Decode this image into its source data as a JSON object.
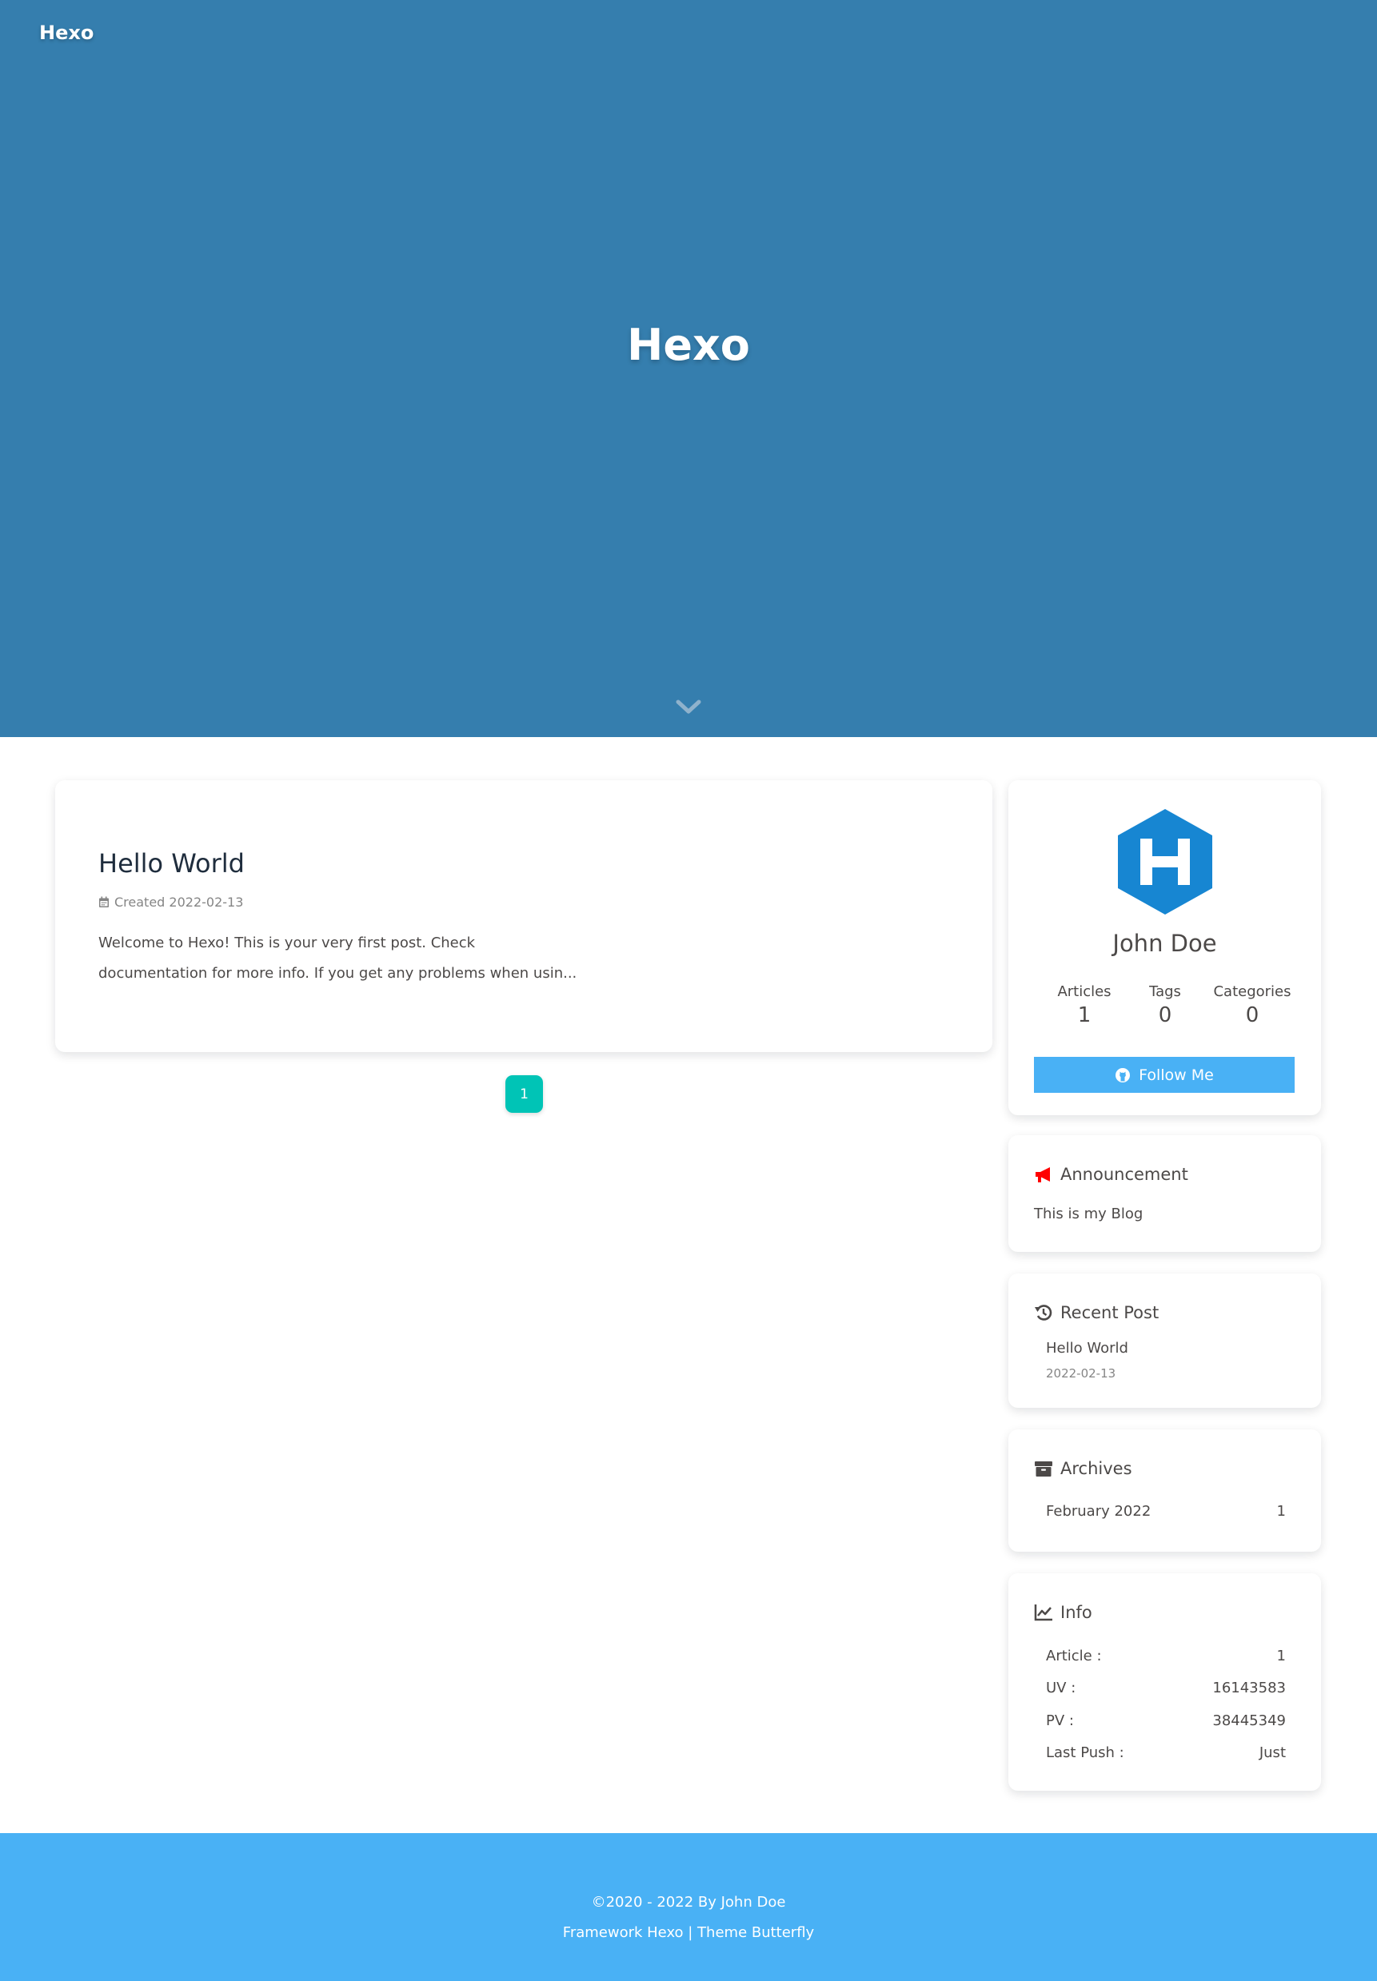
{
  "nav": {
    "brand": "Hexo"
  },
  "hero": {
    "title": "Hexo"
  },
  "post": {
    "title": "Hello World",
    "meta": "Created 2022-02-13",
    "excerpt": "Welcome to Hexo! This is your very first post. Check documentation for more info. If you get any problems when usin..."
  },
  "pagination": {
    "current": "1"
  },
  "author": {
    "name": "John Doe",
    "stats": [
      {
        "label": "Articles",
        "value": "1"
      },
      {
        "label": "Tags",
        "value": "0"
      },
      {
        "label": "Categories",
        "value": "0"
      }
    ],
    "follow_label": "Follow Me"
  },
  "announcement": {
    "title": "Announcement",
    "text": "This is my Blog"
  },
  "recent": {
    "title": "Recent Post",
    "post_title": "Hello World",
    "post_date": "2022-02-13"
  },
  "archives": {
    "title": "Archives",
    "month": "February 2022",
    "count": "1"
  },
  "info": {
    "title": "Info",
    "rows": [
      {
        "label": "Article :",
        "value": "1"
      },
      {
        "label": "UV :",
        "value": "16143583"
      },
      {
        "label": "PV :",
        "value": "38445349"
      },
      {
        "label": "Last Push :",
        "value": "Just"
      }
    ]
  },
  "footer": {
    "copyright": "©2020 - 2022 By John Doe",
    "framework": "Framework Hexo | Theme Butterfly"
  },
  "colors": {
    "hero_bg": "#357eae",
    "accent": "#49b1f5",
    "pagination": "#00c4b6",
    "announcement_icon": "#ff0000",
    "hexo_logo": "#1786d2"
  }
}
